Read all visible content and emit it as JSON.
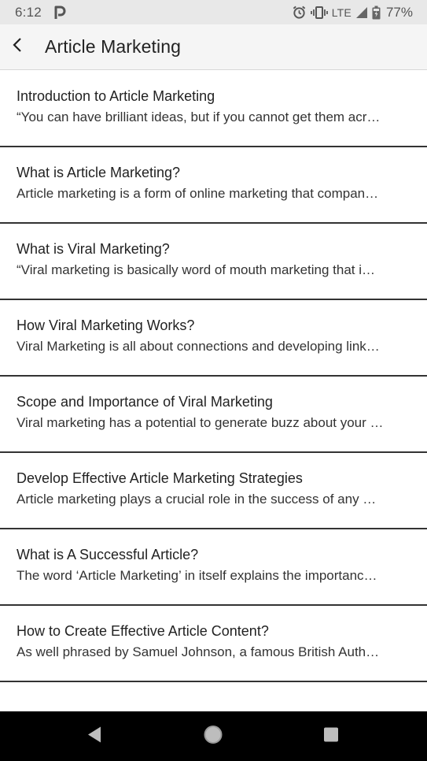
{
  "status_bar": {
    "time": "6:12",
    "network": "LTE",
    "battery": "77%",
    "icons": [
      "parking-app-icon",
      "alarm-icon",
      "vibrate-icon",
      "signal-icon",
      "battery-icon"
    ]
  },
  "app_bar": {
    "title": "Article Marketing",
    "back_icon": "chevron-left-icon"
  },
  "articles": [
    {
      "title": "Introduction to Article Marketing",
      "snippet": "“You can have brilliant ideas, but if you cannot get them acr…"
    },
    {
      "title": "What is Article Marketing?",
      "snippet": "Article marketing is a form of online marketing that compan…"
    },
    {
      "title": "What is Viral Marketing?",
      "snippet": "“Viral marketing is basically word of mouth marketing that i…"
    },
    {
      "title": "How Viral Marketing Works?",
      "snippet": "Viral Marketing is all about connections and developing link…"
    },
    {
      "title": "Scope and Importance of Viral Marketing",
      "snippet": "Viral marketing has a potential to generate buzz about your …"
    },
    {
      "title": "Develop Effective Article Marketing Strategies",
      "snippet": "Article marketing plays a crucial role in the success of any …"
    },
    {
      "title": "What is A Successful Article?",
      "snippet": "The word ‘Article Marketing’ in itself explains the importanc…"
    },
    {
      "title": "How to Create Effective Article Content?",
      "snippet": "As well phrased by Samuel Johnson, a famous British Auth…"
    }
  ],
  "nav_bar": {
    "icons": [
      "back-triangle-icon",
      "home-circle-icon",
      "recents-square-icon"
    ]
  },
  "colors": {
    "status_bar_bg": "#e8e8e8",
    "app_bar_bg": "#f5f5f5",
    "divider": "#333333",
    "nav_bar_bg": "#000000"
  }
}
